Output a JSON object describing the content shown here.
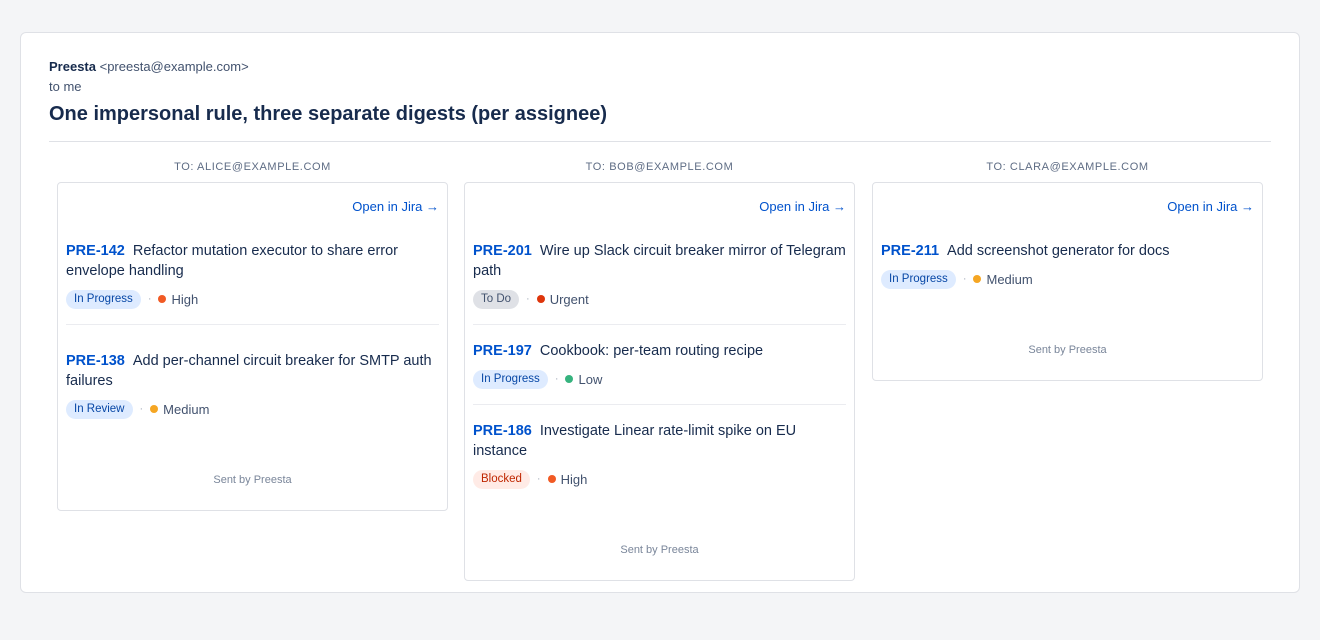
{
  "email": {
    "sender_name": "Preesta",
    "sender_email": "<preesta@example.com>",
    "to_line": "to me",
    "subject": "One impersonal rule, three separate digests (per assignee)"
  },
  "colors": {
    "link": "#0052cc",
    "high": "#f15a24",
    "urgent": "#de350b",
    "medium": "#f5a623",
    "low": "#36b37e"
  },
  "digests": [
    {
      "to_label": "TO: ALICE@EXAMPLE.COM",
      "open_link": "Open in Jira →",
      "footer": "Sent by Preesta",
      "issues": [
        {
          "key": "PRE-142",
          "title": "Refactor mutation executor to share error envelope handling",
          "status": "In Progress",
          "priority": "High"
        },
        {
          "key": "PRE-138",
          "title": "Add per-channel circuit breaker for SMTP auth failures",
          "status": "In Review",
          "priority": "Medium"
        }
      ]
    },
    {
      "to_label": "TO: BOB@EXAMPLE.COM",
      "open_link": "Open in Jira →",
      "footer": "Sent by Preesta",
      "issues": [
        {
          "key": "PRE-201",
          "title": "Wire up Slack circuit breaker mirror of Telegram path",
          "status": "To Do",
          "priority": "Urgent"
        },
        {
          "key": "PRE-197",
          "title": "Cookbook: per-team routing recipe",
          "status": "In Progress",
          "priority": "Low"
        },
        {
          "key": "PRE-186",
          "title": "Investigate Linear rate-limit spike on EU instance",
          "status": "Blocked",
          "priority": "High"
        }
      ]
    },
    {
      "to_label": "TO: CLARA@EXAMPLE.COM",
      "open_link": "Open in Jira →",
      "footer": "Sent by Preesta",
      "issues": [
        {
          "key": "PRE-211",
          "title": "Add screenshot generator for docs",
          "status": "In Progress",
          "priority": "Medium"
        }
      ]
    }
  ]
}
